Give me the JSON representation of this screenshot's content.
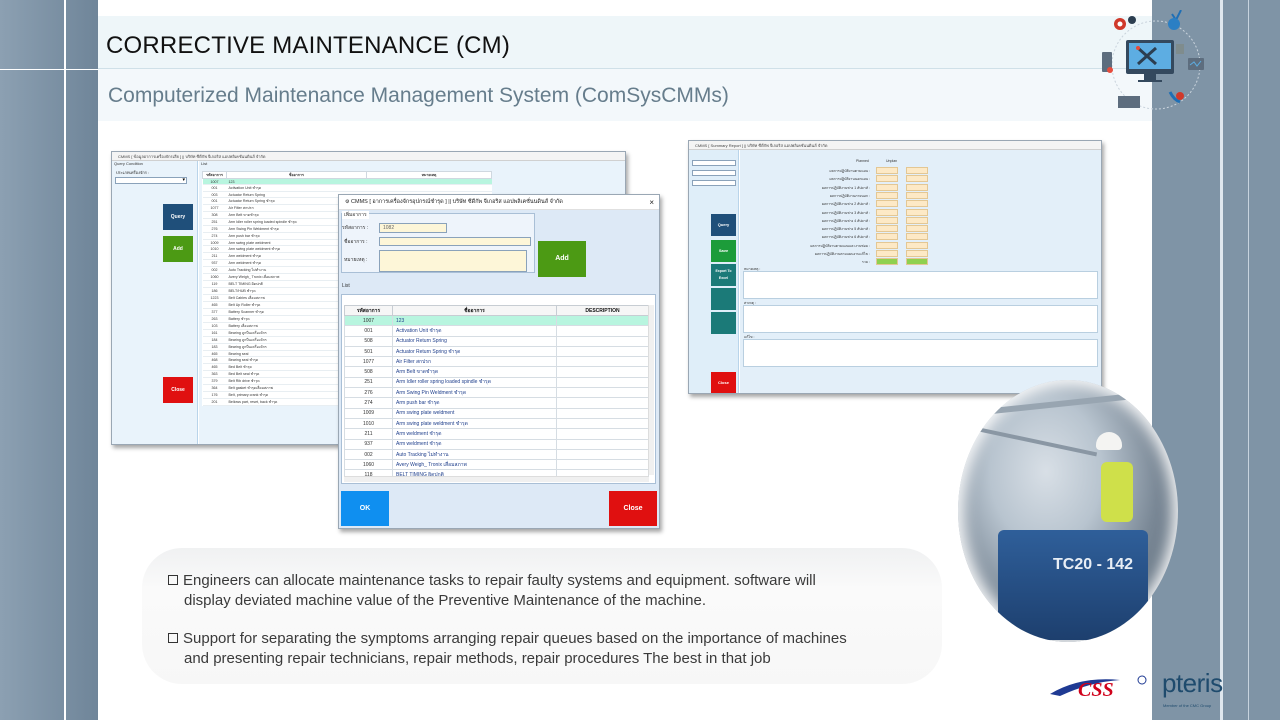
{
  "slide": {
    "title": "CORRECTIVE MAINTENANCE (CM)",
    "subtitle": "Computerized Maintenance Management System (ComSysCMMs)"
  },
  "bullets": [
    {
      "line1": "Engineers can allocate maintenance tasks to repair faulty systems and equipment.  software will",
      "line2": "display deviated machine value of the Preventive Maintenance of the machine."
    },
    {
      "line1": "Support for separating the symptoms arranging repair queues based on the importance of machines",
      "line2": "and presenting repair technicians, repair methods, repair procedures The best in that job"
    }
  ],
  "window1": {
    "title": "CMMS [ ข้อมูลอาการเครื่องจักรเสีย ] || บริษัท ซีดีกัพ จีเกอริส แอปพลิเคชั่นนดินส์ จำกัด",
    "search_group": "Query Condition",
    "search_label": "ประเภทเครื่องจักร :",
    "list_group": "List",
    "query_label": "Query",
    "add_label": "Add",
    "close_label": "Close",
    "columns": [
      "รหัสอาการ",
      "ชื่ออาการ",
      "หมายเหตุ"
    ],
    "rows": [
      [
        "1007",
        "123"
      ],
      [
        "001",
        "Activation Unit ชำรุด"
      ],
      [
        "003",
        "Actuator Return Spring"
      ],
      [
        "001",
        "Actuator Return Spring ชำรุด"
      ],
      [
        "1077",
        "Air Filter สกปรก"
      ],
      [
        "308",
        "Arm Belt ขาดชำรุด"
      ],
      [
        "251",
        "Arm Idler roller spring loaded spindle ชำรุด"
      ],
      [
        "276",
        "Arm Swing Pin Weldment ชำรุด"
      ],
      [
        "274",
        "Arm push bar ชำรุด"
      ],
      [
        "1009",
        "Arm swing plate weldment"
      ],
      [
        "1010",
        "Arm swing plate weldment ชำรุด"
      ],
      [
        "211",
        "Arm weldment ชำรุด"
      ],
      [
        "937",
        "Arm weldment ชำรุด"
      ],
      [
        "002",
        "Auto Tracking ไม่ทำงาน"
      ],
      [
        "1060",
        "Avery Weigh_ Tronix เสื่อมสภาพ"
      ],
      [
        "119",
        "BELT TIMING ผิดปกติ"
      ],
      [
        "186",
        "BELT/HUB ชำรุด"
      ],
      [
        "1223",
        "Belt Cables เสื่อมสภาพ"
      ],
      [
        "465",
        "Belt Up Roller ชำรุด"
      ],
      [
        "377",
        "Battery Scanner ชำรุด"
      ],
      [
        "263",
        "Battery ชำรุด"
      ],
      [
        "103",
        "Battery เสื่อมสภาพ"
      ],
      [
        "161",
        "Bearing ลูกปืนเครื่องจักร"
      ],
      [
        "184",
        "Bearing ลูกปืนเครื่องจักร"
      ],
      [
        "183",
        "Bearing ลูกปืนเครื่องจักร"
      ],
      [
        "465",
        "Bearing seal"
      ],
      [
        "468",
        "Bearing seal ชำรุด"
      ],
      [
        "465",
        "Bed Belt ชำรุด"
      ],
      [
        "363",
        "Bed Belt seal ชำรุด"
      ],
      [
        "379",
        "Belt Rib drive ชำรุด"
      ],
      [
        "364",
        "Belt gasket ชำรุดเสื่อมสภาพ"
      ],
      [
        "176",
        "Belt, primary crank ชำรุด"
      ],
      [
        "201",
        "Bellows part, reset, back ชำรุด"
      ]
    ]
  },
  "dialog": {
    "title": "CMMS [ อาการเครื่องจักรอุปกรณ์ชำรุด ] || บริษัท ซีดีกัพ จีเกอริส แอปพลิเคชั่นนดินส์ จำกัด",
    "group_label": "เพิ่มอาการ",
    "code_label": "รหัสอาการ :",
    "code_value": "1082",
    "name_label": "ชื่ออาการ :",
    "note_label": "หมายเหตุ :",
    "add_label": "Add",
    "list_label": "List",
    "columns": [
      "รหัสอาการ",
      "ชื่ออาการ",
      "DESCRIPTION"
    ],
    "rows": [
      [
        "1007",
        "123"
      ],
      [
        "001",
        "Activation Unit ชำรุด"
      ],
      [
        "508",
        "Actuator Return Spring"
      ],
      [
        "501",
        "Actuator Return Spring ชำรุด"
      ],
      [
        "1077",
        "Air Filter สกปรก"
      ],
      [
        "508",
        "Arm Belt ขาดชำรุด"
      ],
      [
        "251",
        "Arm Idler roller spring loaded spindle ชำรุด"
      ],
      [
        "276",
        "Arm Swing Pin Weldment ชำรุด"
      ],
      [
        "274",
        "Arm push bar ชำรุด"
      ],
      [
        "1009",
        "Arm swing plate weldment"
      ],
      [
        "1010",
        "Arm swing plate weldment ชำรุด"
      ],
      [
        "211",
        "Arm weldment ชำรุด"
      ],
      [
        "937",
        "Arm weldment ชำรุด"
      ],
      [
        "002",
        "Auto Tracking ไม่ทำงาน"
      ],
      [
        "1060",
        "Avery Weigh_ Tronix เสื่อมสภาพ"
      ],
      [
        "118",
        "BELT TIMING ผิดปกติ"
      ]
    ],
    "ok_label": "OK",
    "close_label": "Close"
  },
  "window3": {
    "title": "CMMS [ Summary Report ] || บริษัท ซีดีกัพ จีเกอริส แอปพลิเคชั่นนดินส์ จำกัด",
    "query_label": "Query",
    "save_label": "Save",
    "export_label": "Export To Excel",
    "close_label": "Close",
    "col_a": "Planned",
    "col_b": "Unplan",
    "rows": [
      "ผลการปฏิบัติงานตามแผน :",
      "ผลการปฏิบัติงานนอกแผน :",
      "ผลการปฏิบัติงานช่าง 1 สัปดาห์ :",
      "ผลการปฏิบัติงานภายนอก :",
      "ผลการปฏิบัติงานช่าง 2 สัปดาห์ :",
      "ผลการปฏิบัติงานช่าง 3 สัปดาห์ :",
      "ผลการปฏิบัติงานช่าง 4 สัปดาห์ :",
      "ผลการปฏิบัติงานช่าง 5 สัปดาห์ :",
      "ผลการปฏิบัติงานช่าง 6 สัปดาห์ :",
      "ผลการปฏิบัติงานตามแผนและงานซ่อม :",
      "ผลการปฏิบัติงานตามแผนงานแก้ไข :",
      "รวม :"
    ],
    "box1_label": "หมายเหตุ :",
    "box2_label": "สาเหตุ :",
    "box3_label": "แก้ไข :"
  },
  "photo": {
    "machine_label": "TC20 - 142"
  },
  "logos": {
    "css": "CSS",
    "pteris": "pteris",
    "pteris_sub": "Member of the CMC Group"
  },
  "colors": {
    "query_button": "#1f4f7a",
    "add_button": "#4c9a14",
    "close_button": "#e01010",
    "ok_button": "#0f8ff0",
    "selected_row": "#b8f5df",
    "frame_band": "#7f94a6"
  }
}
